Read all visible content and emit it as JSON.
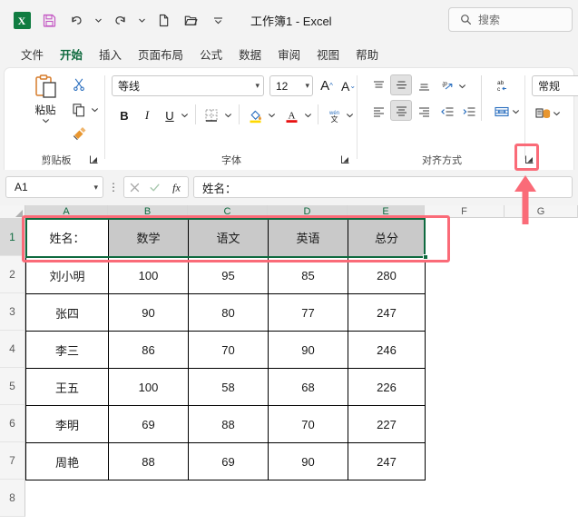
{
  "titlebar": {
    "app_logo": "excel-logo",
    "logo_letter": "X",
    "quick_access": [
      {
        "name": "save-icon",
        "label": "保存"
      },
      {
        "name": "undo-icon",
        "label": "撤消"
      },
      {
        "name": "redo-icon",
        "label": "恢复"
      },
      {
        "name": "new-file-icon",
        "label": "新建"
      },
      {
        "name": "open-folder-icon",
        "label": "打开"
      },
      {
        "name": "customize-qat-icon",
        "label": "自定义快速访问工具栏"
      }
    ],
    "document_title": "工作簿1 - Excel"
  },
  "search": {
    "placeholder": "搜索",
    "icon": "search-icon"
  },
  "ribbon": {
    "tabs": [
      {
        "label": "文件",
        "active": false
      },
      {
        "label": "开始",
        "active": true
      },
      {
        "label": "插入",
        "active": false
      },
      {
        "label": "页面布局",
        "active": false
      },
      {
        "label": "公式",
        "active": false
      },
      {
        "label": "数据",
        "active": false
      },
      {
        "label": "审阅",
        "active": false
      },
      {
        "label": "视图",
        "active": false
      },
      {
        "label": "帮助",
        "active": false
      }
    ],
    "groups": {
      "clipboard": {
        "label": "剪贴板",
        "paste_label": "粘贴",
        "buttons": [
          {
            "name": "cut-icon",
            "label": "剪切"
          },
          {
            "name": "copy-icon",
            "label": "复制"
          },
          {
            "name": "format-painter-icon",
            "label": "格式刷"
          }
        ],
        "launcher": "dialog-launcher-icon"
      },
      "font": {
        "label": "字体",
        "font_name": "等线",
        "font_size": "12",
        "grow_font": "A",
        "shrink_font": "A",
        "bold": "B",
        "italic": "I",
        "underline": "U",
        "borders": "borders-icon",
        "fill_color": "fill-color-icon",
        "font_color": "font-color-icon",
        "phonetic": "phonetic-guide-icon",
        "launcher": "dialog-launcher-icon"
      },
      "alignment": {
        "label": "对齐方式",
        "top_align": "align-top-icon",
        "middle_align": "align-middle-icon",
        "bottom_align": "align-bottom-icon",
        "orientation": "text-orientation-icon",
        "wrap_text": "wrap-text-icon",
        "align_left": "align-left-icon",
        "align_center": "align-center-icon",
        "align_right": "align-right-icon",
        "decrease_indent": "decrease-indent-icon",
        "increase_indent": "increase-indent-icon",
        "merge_cells": "merge-center-icon",
        "launcher": "dialog-launcher-icon"
      },
      "number": {
        "format_value": "常规",
        "accounting": "accounting-format-icon"
      }
    }
  },
  "formula_bar": {
    "name_box": "A1",
    "cancel_icon": "cancel-icon",
    "enter_icon": "enter-icon",
    "fx_icon": "insert-function-icon",
    "content": "姓名："
  },
  "sheet": {
    "columns": [
      "A",
      "B",
      "C",
      "D",
      "E",
      "F",
      "G"
    ],
    "selected_columns": [
      "A",
      "B",
      "C",
      "D",
      "E"
    ],
    "rows": [
      "1",
      "2",
      "3",
      "4",
      "5",
      "6",
      "7",
      "8"
    ],
    "selected_rows": [
      "1"
    ],
    "selection_range": "A1:E1",
    "active_cell": "A1",
    "header_row": [
      "姓名：",
      "数学",
      "语文",
      "英语",
      "总分"
    ],
    "data_rows": [
      [
        "刘小明",
        "100",
        "95",
        "85",
        "280"
      ],
      [
        "张四",
        "90",
        "80",
        "77",
        "247"
      ],
      [
        "李三",
        "86",
        "70",
        "90",
        "246"
      ],
      [
        "王五",
        "100",
        "58",
        "68",
        "226"
      ],
      [
        "李明",
        "69",
        "88",
        "70",
        "227"
      ],
      [
        "周艳",
        "88",
        "69",
        "90",
        "247"
      ]
    ]
  },
  "annotation": {
    "highlight_target": "alignment-dialog-launcher",
    "highlight_color": "#fa6b78",
    "selection_highlight": "A1:E1",
    "arrow": "red-up-arrow"
  }
}
